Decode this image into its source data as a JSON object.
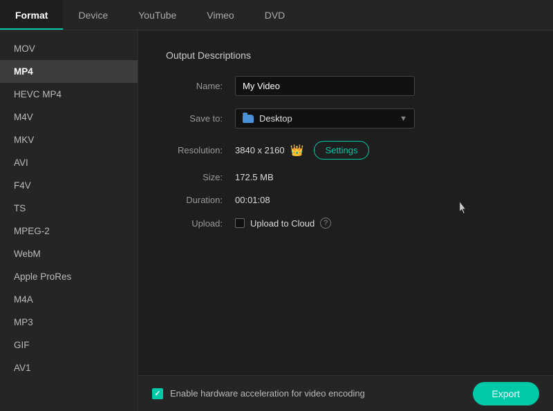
{
  "tabs": [
    {
      "id": "format",
      "label": "Format",
      "active": true
    },
    {
      "id": "device",
      "label": "Device",
      "active": false
    },
    {
      "id": "youtube",
      "label": "YouTube",
      "active": false
    },
    {
      "id": "vimeo",
      "label": "Vimeo",
      "active": false
    },
    {
      "id": "dvd",
      "label": "DVD",
      "active": false
    }
  ],
  "sidebar": {
    "items": [
      {
        "id": "mov",
        "label": "MOV",
        "selected": false
      },
      {
        "id": "mp4",
        "label": "MP4",
        "selected": true
      },
      {
        "id": "hevc-mp4",
        "label": "HEVC MP4",
        "selected": false
      },
      {
        "id": "m4v",
        "label": "M4V",
        "selected": false
      },
      {
        "id": "mkv",
        "label": "MKV",
        "selected": false
      },
      {
        "id": "avi",
        "label": "AVI",
        "selected": false
      },
      {
        "id": "f4v",
        "label": "F4V",
        "selected": false
      },
      {
        "id": "ts",
        "label": "TS",
        "selected": false
      },
      {
        "id": "mpeg2",
        "label": "MPEG-2",
        "selected": false
      },
      {
        "id": "webm",
        "label": "WebM",
        "selected": false
      },
      {
        "id": "apple-prores",
        "label": "Apple ProRes",
        "selected": false
      },
      {
        "id": "m4a",
        "label": "M4A",
        "selected": false
      },
      {
        "id": "mp3",
        "label": "MP3",
        "selected": false
      },
      {
        "id": "gif",
        "label": "GIF",
        "selected": false
      },
      {
        "id": "av1",
        "label": "AV1",
        "selected": false
      }
    ]
  },
  "output": {
    "section_title": "Output Descriptions",
    "name_label": "Name:",
    "name_value": "My Video",
    "name_placeholder": "My Video",
    "save_to_label": "Save to:",
    "save_to_value": "Desktop",
    "resolution_label": "Resolution:",
    "resolution_value": "3840 x 2160",
    "settings_label": "Settings",
    "size_label": "Size:",
    "size_value": "172.5 MB",
    "duration_label": "Duration:",
    "duration_value": "00:01:08",
    "upload_label": "Upload:",
    "upload_to_cloud_label": "Upload to Cloud"
  },
  "bottom": {
    "hardware_accel_label": "Enable hardware acceleration for video encoding",
    "export_label": "Export"
  },
  "colors": {
    "accent": "#00c9a7",
    "selected_bg": "#3d3d3d"
  }
}
